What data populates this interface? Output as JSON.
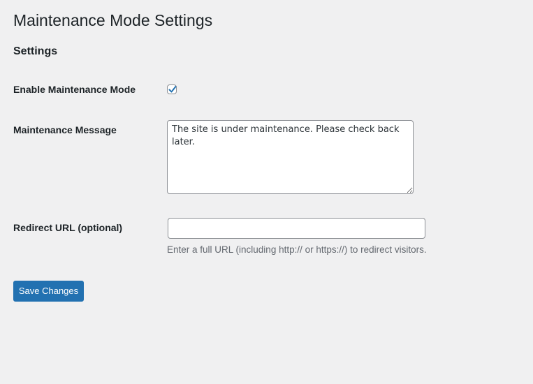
{
  "page": {
    "title": "Maintenance Mode Settings"
  },
  "section": {
    "title": "Settings"
  },
  "fields": {
    "enable": {
      "label": "Enable Maintenance Mode",
      "checked": true
    },
    "message": {
      "label": "Maintenance Message",
      "value": "The site is under maintenance. Please check back later."
    },
    "redirect": {
      "label": "Redirect URL (optional)",
      "value": "",
      "description": "Enter a full URL (including http:// or https://) to redirect visitors."
    }
  },
  "actions": {
    "save_label": "Save Changes"
  },
  "colors": {
    "background": "#f0f0f1",
    "accent": "#2271b1",
    "text": "#1d2327",
    "muted": "#646970"
  }
}
